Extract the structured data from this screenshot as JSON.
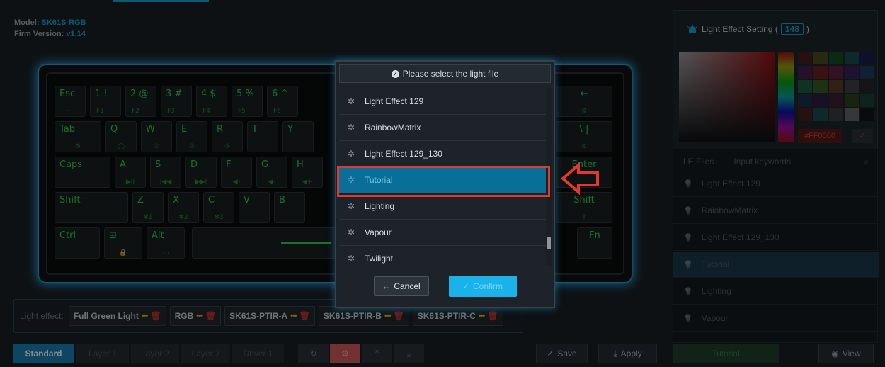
{
  "device": {
    "model_label": "Model:",
    "model_value": "SK61S-RGB",
    "firm_label": "Firm Version:",
    "firm_value": "v1.14"
  },
  "keyboard": {
    "row1": [
      {
        "main": "Esc",
        "sub": "· ~"
      },
      {
        "main": "1 !",
        "sub": "F1"
      },
      {
        "main": "2 @",
        "sub": "F2"
      },
      {
        "main": "3 #",
        "sub": "F3"
      },
      {
        "main": "4 $",
        "sub": "F4"
      },
      {
        "main": "5 %",
        "sub": "F5"
      },
      {
        "main": "6 ^",
        "sub": "F6"
      }
    ],
    "row2": [
      {
        "main": "Tab",
        "sub": "⚙"
      },
      {
        "main": "Q",
        "sub": "◯"
      },
      {
        "main": "W",
        "sub": "①"
      },
      {
        "main": "E",
        "sub": "②"
      },
      {
        "main": "R",
        "sub": "③"
      },
      {
        "main": "T",
        "sub": ""
      },
      {
        "main": "Y",
        "sub": ""
      }
    ],
    "row3": [
      {
        "main": "Caps",
        "sub": ""
      },
      {
        "main": "A",
        "sub": "▶II"
      },
      {
        "main": "S",
        "sub": "I◀◀"
      },
      {
        "main": "D",
        "sub": "▶▶I"
      },
      {
        "main": "F",
        "sub": "◀)"
      },
      {
        "main": "G",
        "sub": "◀-"
      },
      {
        "main": "H",
        "sub": "◀+"
      }
    ],
    "row4": [
      {
        "main": "Shift",
        "sub": ""
      },
      {
        "main": "Z",
        "sub": "✻1"
      },
      {
        "main": "X",
        "sub": "✻2"
      },
      {
        "main": "C",
        "sub": "✻3"
      },
      {
        "main": "V",
        "sub": ""
      },
      {
        "main": "B",
        "sub": ""
      }
    ],
    "row5": [
      {
        "main": "Ctrl",
        "sub": ""
      },
      {
        "main": "⊞",
        "sub": "🔒"
      },
      {
        "main": "Alt",
        "sub": "▭"
      }
    ],
    "right_keys": {
      "backspace": "←",
      "backspace_sub": "⚙",
      "backslash": "\\ |",
      "backslash_sub": "⊙",
      "enter": "Enter",
      "rshift": "Shift",
      "rshift_sub": "↑",
      "fn": "Fn"
    }
  },
  "light_effect_bar": {
    "label": "Light effect:",
    "chips": [
      {
        "name": "Full Green Light",
        "dots": "•••",
        "trash": "🗑"
      },
      {
        "name": "RGB",
        "dots": "•••",
        "trash": "🗑"
      },
      {
        "name": "SK61S-PTIR-A",
        "dots": "•••",
        "trash": "🗑"
      },
      {
        "name": "SK61S-PTIR-B",
        "dots": "•••",
        "trash": "🗑"
      },
      {
        "name": "SK61S-PTIR-C",
        "dots": "•••",
        "trash": "🗑"
      }
    ]
  },
  "toolbar": {
    "tabs": [
      "Standard",
      "Layer 1",
      "Layer 2",
      "Layer 3",
      "Driver 1"
    ],
    "tool_icons": [
      "↻",
      "⚙",
      "⤒",
      "⤓"
    ],
    "save_label": "Save",
    "save_icon": "✓",
    "apply_label": "Apply",
    "apply_icon": "⤓"
  },
  "right_panel": {
    "title": "Light Effect Setting (",
    "count": "148",
    "title_close": ")",
    "hex_value": "#FF0000",
    "hex_btn": "✓",
    "tab_files": "LE Files",
    "tab_keywords": "Input keywords",
    "search_icon": "⌕",
    "items": [
      "Light Effect 129",
      "RainbowMatrix",
      "Light Effect 129_130",
      "Tutorial",
      "Lighting",
      "Vapour"
    ],
    "selected": "Tutorial",
    "view_label": "View",
    "view_icon": "◉",
    "swatches": [
      "#6b1a1a",
      "#6b6b1a",
      "#1a6b1a",
      "#1a6b6b",
      "#1a1a6b",
      "#6b1a6b",
      "#b41e1e",
      "#8a1e4e",
      "#4e1e8a",
      "#1e4e8a",
      "#1e8a4e",
      "#4e8a1e",
      "#8a4e1e",
      "#5a5a5a",
      "#2a2a2a",
      "#1a3a5a",
      "#3a1a5a",
      "#5a1a3a",
      "#3a5a1a",
      "#1a5a3a",
      "#6b1a1a",
      "#1a6b6b",
      "#4e4e4e",
      "#9a9a9a",
      "#0a0a0a"
    ]
  },
  "modal": {
    "title": "Please select the light file",
    "items": [
      "Light Effect 129",
      "RainbowMatrix",
      "Light Effect 129_130",
      "Tutorial",
      "Lighting",
      "Vapour",
      "Twilight"
    ],
    "selected_index": 3,
    "cancel_label": "Cancel",
    "cancel_icon": "←",
    "confirm_label": "Confirm",
    "confirm_icon": "✓"
  }
}
